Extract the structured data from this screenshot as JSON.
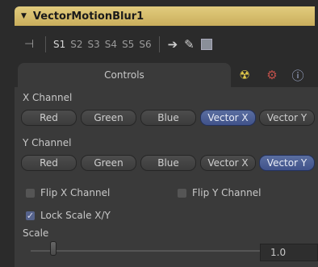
{
  "tool": {
    "title": "VectorMotionBlur1"
  },
  "toolbar": {
    "slots": [
      "S1",
      "S2",
      "S3",
      "S4",
      "S5",
      "S6"
    ]
  },
  "tabs": {
    "controls": "Controls"
  },
  "x_channel": {
    "label": "X Channel",
    "options": [
      "Red",
      "Green",
      "Blue",
      "Vector X",
      "Vector Y"
    ],
    "selected": "Vector X"
  },
  "y_channel": {
    "label": "Y Channel",
    "options": [
      "Red",
      "Green",
      "Blue",
      "Vector X",
      "Vector Y"
    ],
    "selected": "Vector Y"
  },
  "flip_x": {
    "label": "Flip X Channel",
    "checked": false
  },
  "flip_y": {
    "label": "Flip Y Channel",
    "checked": false
  },
  "lock_scale": {
    "label": "Lock Scale X/Y",
    "checked": true
  },
  "scale": {
    "label": "Scale",
    "value": "1.0"
  }
}
